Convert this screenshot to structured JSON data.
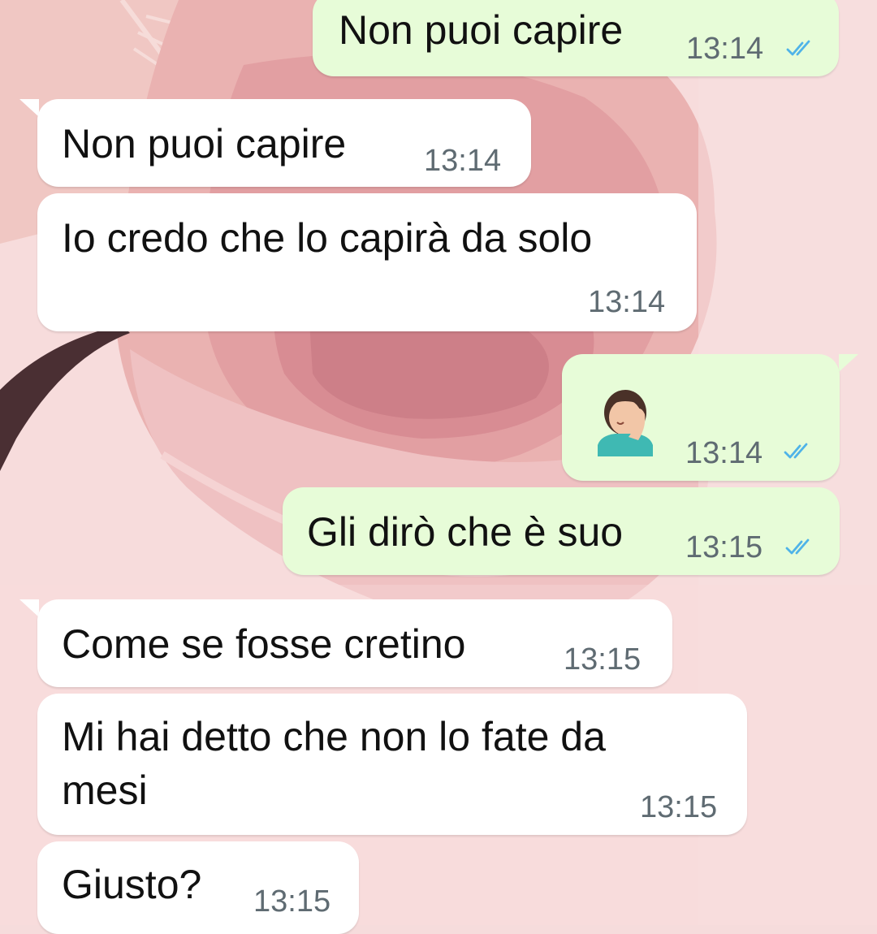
{
  "colors": {
    "incoming_bubble": "#ffffff",
    "outgoing_bubble": "#e7fcd8",
    "read_ticks": "#4fb3e8",
    "timestamp": "#5f6b72"
  },
  "messages": [
    {
      "direction": "outgoing",
      "text": "Non puoi capire",
      "time": "13:14",
      "status": "read-double-tick-icon"
    },
    {
      "direction": "incoming",
      "text": "Non puoi capire",
      "time": "13:14"
    },
    {
      "direction": "incoming",
      "text": "Io credo che lo capirà da solo",
      "time": "13:14"
    },
    {
      "direction": "outgoing",
      "text": "",
      "emoji": "woman-facepalming-icon",
      "time": "13:14",
      "status": "read-double-tick-icon"
    },
    {
      "direction": "outgoing",
      "text": "Gli dirò che è suo",
      "time": "13:15",
      "status": "read-double-tick-icon"
    },
    {
      "direction": "incoming",
      "text": "Come se fosse cretino",
      "time": "13:15"
    },
    {
      "direction": "incoming",
      "text_line1": "Mi hai detto che non lo fate da",
      "text_line2": "mesi",
      "time": "13:15"
    },
    {
      "direction": "incoming",
      "text": "Giusto?",
      "time": "13:15"
    }
  ]
}
